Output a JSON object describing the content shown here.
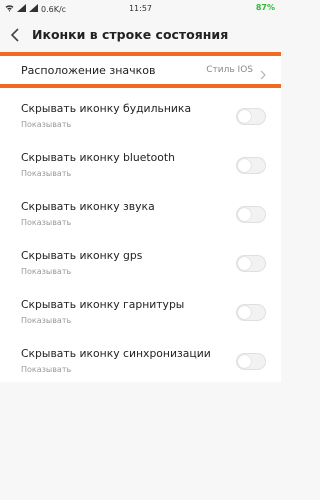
{
  "status_bar": {
    "network_speed": "0.6K/c",
    "time": "11:57",
    "battery": "87%"
  },
  "header": {
    "title": "Иконки в строке состояния",
    "back_icon": "chevron-left-icon"
  },
  "location": {
    "label": "Расположение значков",
    "value": "Стиль IOS",
    "chevron_icon": "chevron-right-icon",
    "highlight_color": "#f06a24"
  },
  "settings": [
    {
      "title": "Скрывать иконку будильника",
      "subtitle": "Показывать",
      "enabled": false
    },
    {
      "title": "Скрывать иконку bluetooth",
      "subtitle": "Показывать",
      "enabled": false
    },
    {
      "title": "Скрывать иконку звука",
      "subtitle": "Показывать",
      "enabled": false
    },
    {
      "title": "Скрывать иконку gps",
      "subtitle": "Показывать",
      "enabled": false
    },
    {
      "title": "Скрывать иконку гарнитуры",
      "subtitle": "Показывать",
      "enabled": false
    },
    {
      "title": "Скрывать иконку синхронизации",
      "subtitle": "Показывать",
      "enabled": false
    }
  ]
}
